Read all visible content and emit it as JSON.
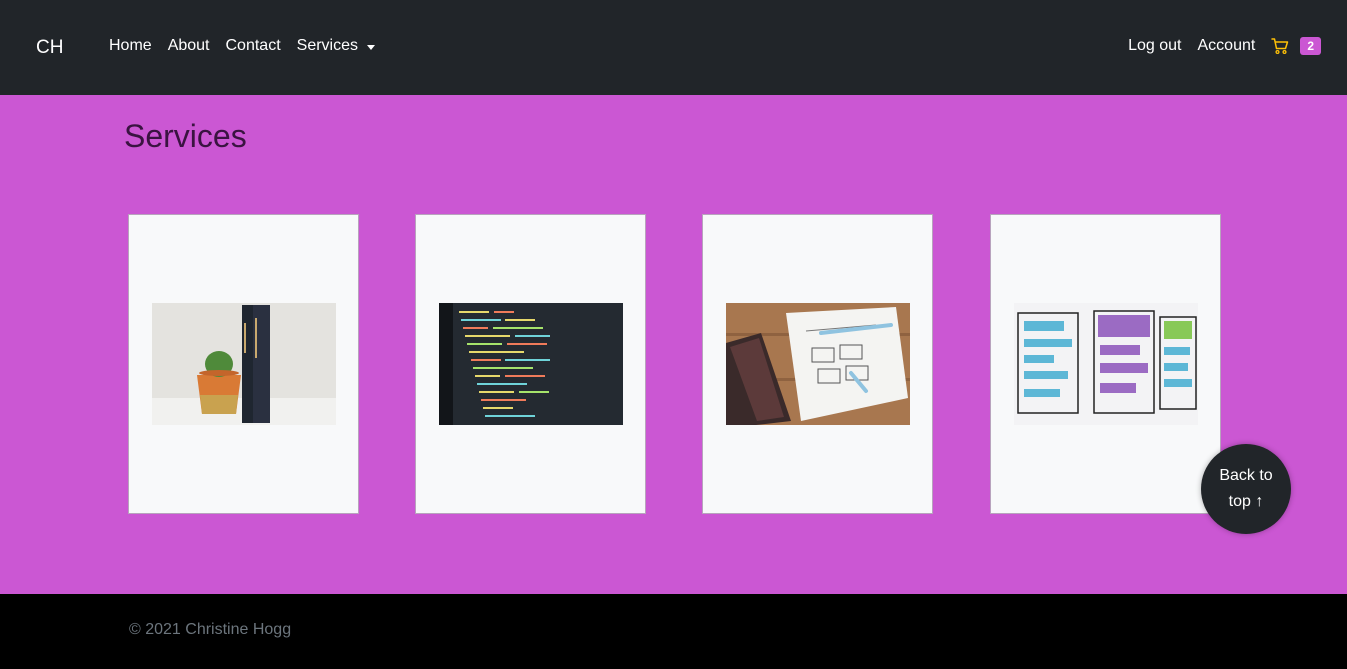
{
  "navbar": {
    "brand": "CH",
    "links": [
      {
        "label": "Home"
      },
      {
        "label": "About"
      },
      {
        "label": "Contact"
      },
      {
        "label": "Services"
      }
    ],
    "right_links": [
      {
        "label": "Log out"
      },
      {
        "label": "Account"
      }
    ],
    "cart_count": "2",
    "cart_icon": "shopping-cart-icon"
  },
  "main": {
    "title": "Services",
    "cards": [
      {
        "image": "books-and-cactus-photo"
      },
      {
        "image": "code-on-screen-photo"
      },
      {
        "image": "notebook-wireframe-sketch-photo"
      },
      {
        "image": "colorful-wireframe-sketch-photo"
      }
    ]
  },
  "back_to_top": {
    "line1": "Back to",
    "line2": "top ↑"
  },
  "footer": {
    "text": "© 2021 Christine Hogg"
  },
  "colors": {
    "navbar_bg": "#212529",
    "page_bg": "#cb57d3",
    "card_bg": "#f8f9fa",
    "footer_bg": "#000000",
    "badge_bg": "#cb57d3",
    "cart_icon": "#ffc107"
  }
}
